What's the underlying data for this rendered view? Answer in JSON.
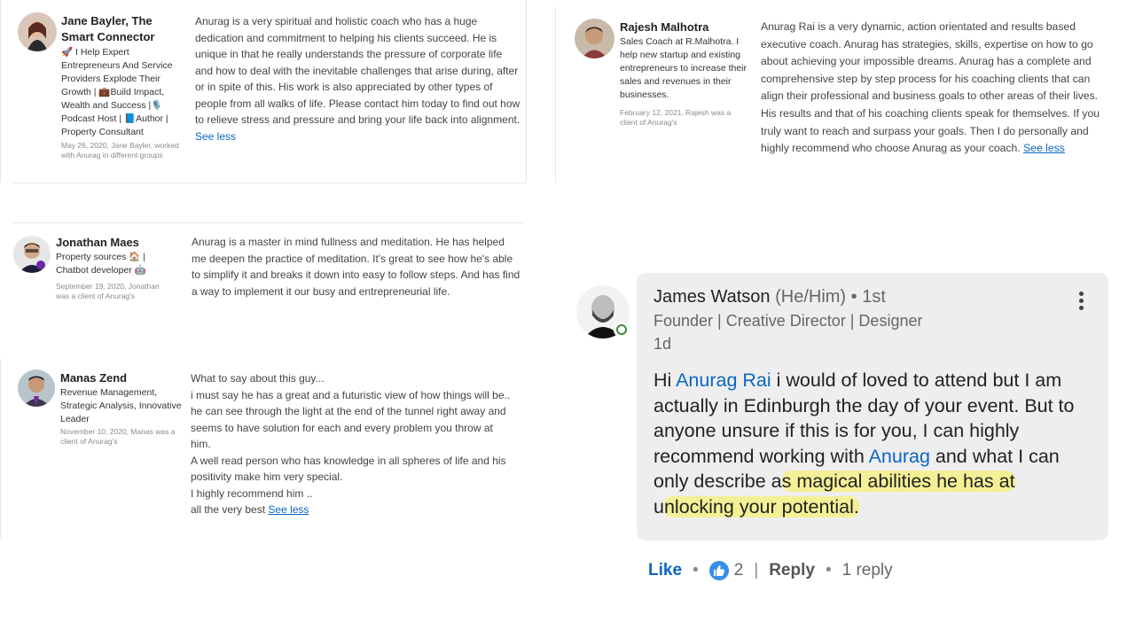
{
  "recommendations": [
    {
      "name": "Jane Bayler, The Smart Connector",
      "headline": "🚀 I Help Expert Entrepreneurs And Service Providers Explode Their Growth | 💼Build Impact, Wealth and Success |🎙️ Podcast Host | 📘Author | Property Consultant",
      "meta": "May 26, 2020, Jane Bayler, worked with Anurag in different groups",
      "text": "Anurag is a very spiritual and holistic coach who has a huge dedication and commitment to helping his clients succeed. He is unique in that he really understands the pressure of corporate life and how to deal with the inevitable challenges that arise during, after or in spite of this. His work is also appreciated by other types of people from all walks of life. Please contact him today to find out how to relieve stress and pressure and bring your life back into alignment.",
      "see_less": "See less"
    },
    {
      "name": "Rajesh Malhotra",
      "headline": "Sales Coach at R.Malhotra. I help new startup and existing entrepreneurs to increase their sales and revenues in their businesses.",
      "meta": "February 12, 2021, Rajesh was a client of Anurag's",
      "text": "Anurag Rai is a very dynamic, action orientated and results based executive coach. Anurag has strategies, skills, expertise on how to go about achieving your impossible dreams. Anurag has a complete and comprehensive step by step process for his coaching clients that can align their professional and business goals to other areas of their lives. His results and that of his coaching clients speak for themselves. If you truly want to reach and surpass your goals. Then I do personally and highly recommend who choose Anurag as your coach.",
      "see_less": "See less"
    },
    {
      "name": "Jonathan Maes",
      "headline": "Property sources 🏠 | Chatbot developer 🤖",
      "meta": "September 19, 2020, Jonathan was a client of Anurag's",
      "text": "Anurag is a master in mind fullness and meditation. He has helped me deepen the practice of meditation. It's great to see how he's able to simplify it and breaks it down into easy to follow steps. And has find a way to implement it our busy and entrepreneurial life."
    },
    {
      "name": "Manas Zend",
      "headline": "Revenue Management, Strategic Analysis, Innovative Leader",
      "meta": "November 10, 2020, Manas was a client of Anurag's",
      "lines": [
        "What to say about this guy...",
        "i must say he has a great and a futuristic view of how things will be..",
        "he can see through the light at the end of the tunnel right away and seems to have solution for each and every problem you throw at him.",
        "A well read person who has knowledge in all spheres of life and his positivity make him very special.",
        "I highly recommend him ..",
        "all the very best"
      ],
      "see_less": "See less"
    }
  ],
  "comment": {
    "author": "James Watson",
    "pronouns": "(He/Him)",
    "degree": "• 1st",
    "headline": "Founder | Creative Director | Designer",
    "time": "1d",
    "body_1": "Hi ",
    "mention_1": "Anurag Rai",
    "body_2": " i would of loved to attend but I am actually in Edinburgh the day of your event. But to anyone unsure if this is for you, I can highly recommend working with ",
    "mention_2": "Anurag",
    "body_3": " and what I can only describe a",
    "highlight_1": "s magical abilities he has at",
    "body_4": " u",
    "highlight_2": "nlocking your potential.",
    "like_label": "Like",
    "like_count": "2",
    "reply_label": "Reply",
    "replies": "1 reply",
    "online_color": "#3a8a3a"
  },
  "colors": {
    "accent": "#0a66c2",
    "highlight": "#f5f078"
  }
}
